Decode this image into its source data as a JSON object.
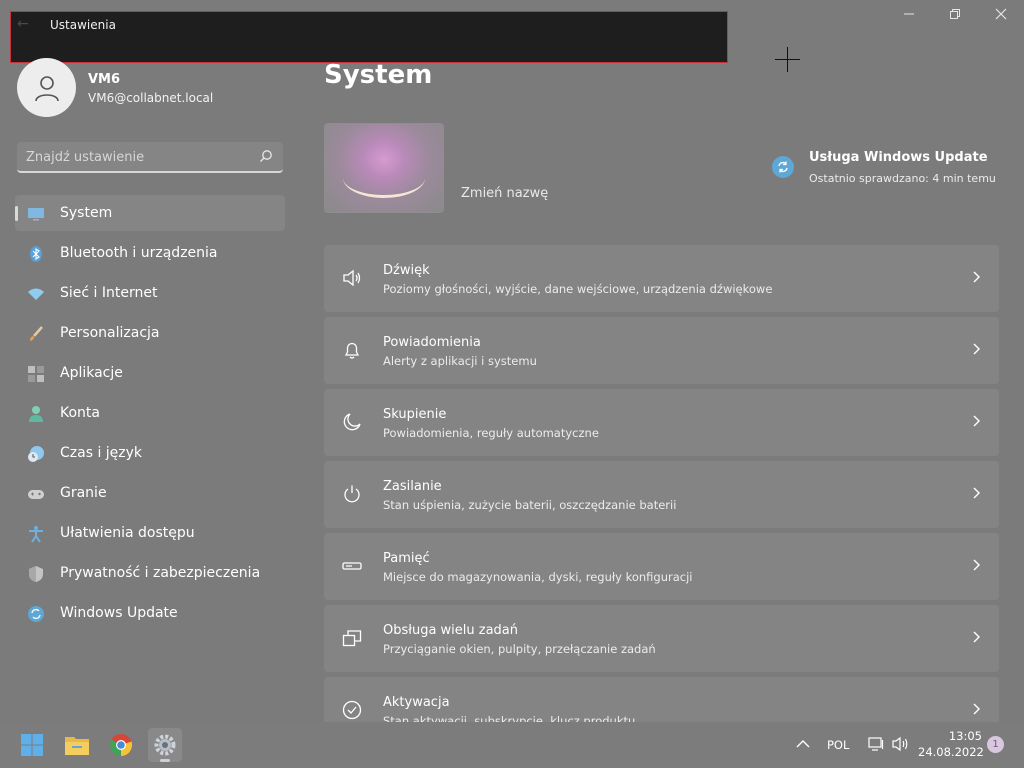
{
  "window": {
    "title": "Ustawienia",
    "controls": {
      "minimize": "—",
      "maximize": "❐",
      "close": "✕"
    }
  },
  "profile": {
    "name": "VM6",
    "email": "VM6@collabnet.local"
  },
  "search": {
    "placeholder": "Znajdź ustawienie"
  },
  "sidebar": {
    "items": [
      {
        "label": "System",
        "icon": "monitor-icon",
        "active": true
      },
      {
        "label": "Bluetooth i urządzenia",
        "icon": "bluetooth-icon"
      },
      {
        "label": "Sieć i Internet",
        "icon": "wifi-icon"
      },
      {
        "label": "Personalizacja",
        "icon": "brush-icon"
      },
      {
        "label": "Aplikacje",
        "icon": "apps-icon"
      },
      {
        "label": "Konta",
        "icon": "person-icon"
      },
      {
        "label": "Czas i język",
        "icon": "clock-globe-icon"
      },
      {
        "label": "Granie",
        "icon": "gamepad-icon"
      },
      {
        "label": "Ułatwienia dostępu",
        "icon": "accessibility-icon"
      },
      {
        "label": "Prywatność i zabezpieczenia",
        "icon": "shield-icon"
      },
      {
        "label": "Windows Update",
        "icon": "windows-update-icon"
      }
    ]
  },
  "main": {
    "title": "System",
    "rename_link": "Zmień nazwę",
    "windows_update": {
      "title": "Usługa Windows Update",
      "status": "Ostatnio sprawdzano: 4 min temu"
    },
    "settings": [
      {
        "title": "Dźwięk",
        "desc": "Poziomy głośności, wyjście, dane wejściowe, urządzenia dźwiękowe",
        "icon": "speaker-icon"
      },
      {
        "title": "Powiadomienia",
        "desc": "Alerty z aplikacji i systemu",
        "icon": "bell-icon"
      },
      {
        "title": "Skupienie",
        "desc": "Powiadomienia, reguły automatyczne",
        "icon": "moon-icon"
      },
      {
        "title": "Zasilanie",
        "desc": "Stan uśpienia, zużycie baterii, oszczędzanie baterii",
        "icon": "power-icon"
      },
      {
        "title": "Pamięć",
        "desc": "Miejsce do magazynowania, dyski, reguły konfiguracji",
        "icon": "storage-icon"
      },
      {
        "title": "Obsługa wielu zadań",
        "desc": "Przyciąganie okien, pulpity, przełączanie zadań",
        "icon": "multitask-icon"
      },
      {
        "title": "Aktywacja",
        "desc": "Stan aktywacji, subskrypcje, klucz produktu",
        "icon": "check-circle-icon"
      }
    ]
  },
  "taskbar": {
    "language": "POL",
    "time": "13:05",
    "date": "24.08.2022",
    "notifications": "1"
  }
}
